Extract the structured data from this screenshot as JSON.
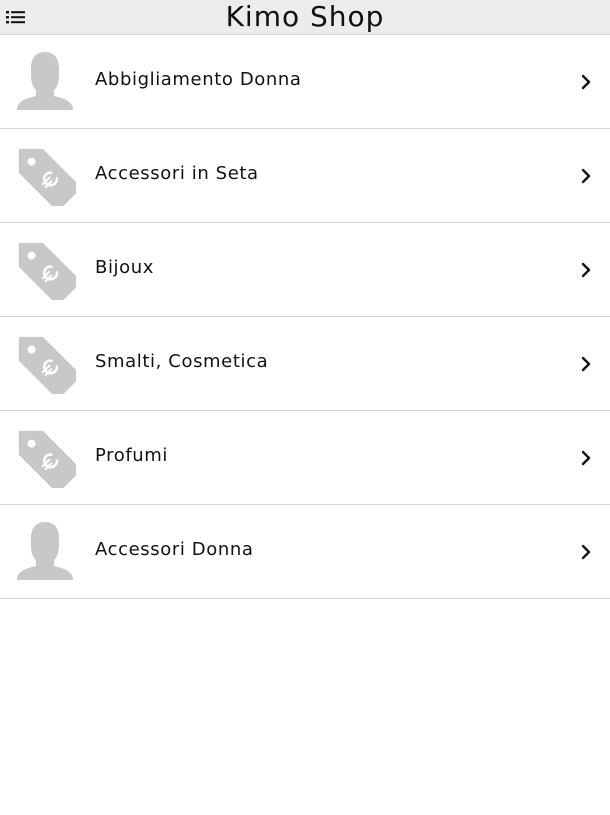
{
  "header": {
    "title": "Kimo Shop",
    "menu_icon": "list-menu-icon"
  },
  "colors": {
    "header_bg": "#ececec",
    "icon_gray": "#c8c8c8",
    "divider": "#d4d4d4"
  },
  "categories": [
    {
      "label": "Abbigliamento Donna",
      "icon": "woman-silhouette-icon"
    },
    {
      "label": "Accessori in Seta",
      "icon": "price-tag-euro-icon"
    },
    {
      "label": "Bijoux",
      "icon": "price-tag-euro-icon"
    },
    {
      "label": "Smalti, Cosmetica",
      "icon": "price-tag-euro-icon"
    },
    {
      "label": "Profumi",
      "icon": "price-tag-euro-icon"
    },
    {
      "label": "Accessori Donna",
      "icon": "woman-silhouette-icon"
    }
  ]
}
